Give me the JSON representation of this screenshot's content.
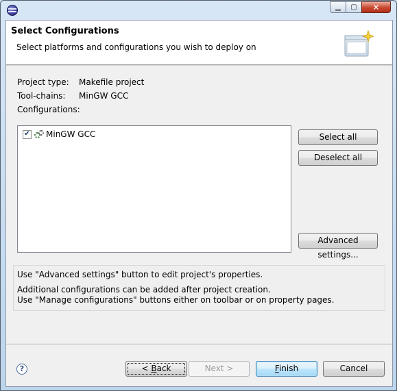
{
  "banner": {
    "title": "Select Configurations",
    "description": "Select platforms and configurations you wish to deploy on"
  },
  "info": {
    "project_type_label": "Project type:",
    "project_type_value": "Makefile project",
    "toolchains_label": "Tool-chains:",
    "toolchains_value": "MinGW GCC",
    "configurations_label": "Configurations:"
  },
  "configurations": [
    {
      "label": "MinGW GCC",
      "checked": true
    }
  ],
  "side_buttons": {
    "select_all": "Select all",
    "deselect_all": "Deselect all",
    "advanced": "Advanced settings..."
  },
  "hints": {
    "line1": "Use \"Advanced settings\" button to edit project's properties.",
    "line2": "Additional configurations can be added after project creation.",
    "line3": "Use \"Manage configurations\" buttons either on toolbar or on property pages."
  },
  "footer": {
    "back_prefix": "< ",
    "back_mnemonic": "B",
    "back_rest": "ack",
    "next": "Next >",
    "finish_mnemonic": "F",
    "finish_rest": "inish",
    "cancel": "Cancel"
  },
  "icons": {
    "app": "eclipse-icon",
    "help": "help-icon",
    "wizard": "new-wizard-icon",
    "config": "gear-icon"
  },
  "colors": {
    "window_frame": "#bcd5ec",
    "client_bg": "#f0f0f0",
    "default_button_border": "#3c7fb1"
  }
}
